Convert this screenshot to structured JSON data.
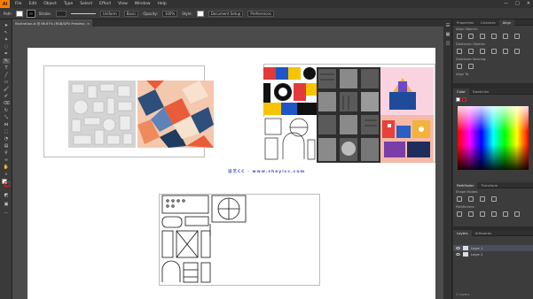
{
  "menubar": {
    "logo": "Ai",
    "items": [
      "File",
      "Edit",
      "Object",
      "Type",
      "Select",
      "Effect",
      "View",
      "Window",
      "Help"
    ],
    "window_controls": [
      "—",
      "□",
      "✕"
    ]
  },
  "controlbar": {
    "selection_label": "Path",
    "stroke_label": "Stroke:",
    "profile_label": "Uniform",
    "basic_label": "Basic",
    "opacity_label": "Opacity:",
    "opacity_value": "100%",
    "style_label": "Style:",
    "doc_setup_label": "Document Setup",
    "prefs_label": "Preferences"
  },
  "document_tab": {
    "title": "Illustration.ai @ 66.67% (RGB/GPU Preview)",
    "close": "×"
  },
  "canvas": {
    "watermark": "设艺CC · www.sheyicc.com"
  },
  "panels": {
    "top_tabs": [
      "Properties",
      "Libraries",
      "Align"
    ],
    "align_objects_label": "Align Objects:",
    "distribute_objects_label": "Distribute Objects:",
    "distribute_spacing_label": "Distribute Spacing:",
    "align_to_label": "Align To:",
    "color_tabs": [
      "Color",
      "Swatches"
    ],
    "pathfinder_tabs": [
      "Pathfinder",
      "Transform"
    ],
    "shape_modes_label": "Shape Modes:",
    "pathfinders_label": "Pathfinders:",
    "layers_tabs": [
      "Layers",
      "Artboards"
    ],
    "layers": [
      {
        "name": "Layer 1",
        "selected": true
      },
      {
        "name": "Layer 2",
        "selected": false
      }
    ],
    "layers_status": "2 Layers"
  },
  "colors": {
    "app_orange": "#ff7c00",
    "pasteboard": "#4b4b4b",
    "artboard": "#ffffff",
    "watermark_blue": "#3a57c9"
  }
}
